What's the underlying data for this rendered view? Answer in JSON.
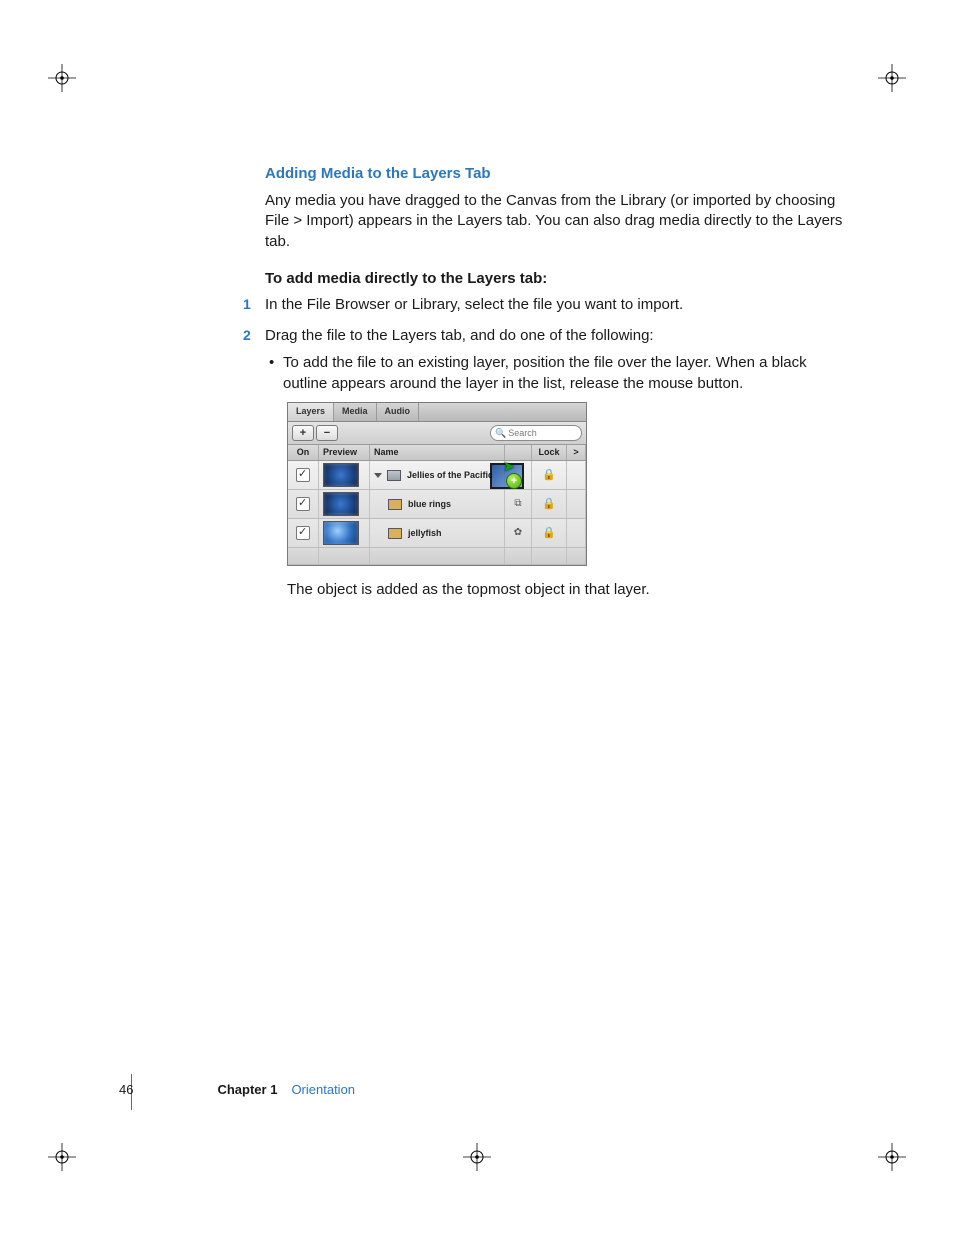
{
  "heading": "Adding Media to the Layers Tab",
  "intro": "Any media you have dragged to the Canvas from the Library (or imported by choosing File > Import) appears in the Layers tab. You can also drag media directly to the Layers tab.",
  "subhead": "To add media directly to the Layers tab:",
  "steps": {
    "s1": "In the File Browser or Library, select the file you want to import.",
    "s2": "Drag the file to the Layers tab, and do one of the following:",
    "bullet1": "To add the file to an existing layer, position the file over the layer. When a black outline appears around the layer in the list, release the mouse button."
  },
  "afterPanel": "The object is added as the topmost object in that layer.",
  "panel": {
    "tabs": {
      "t1": "Layers",
      "t2": "Media",
      "t3": "Audio"
    },
    "addLabel": "+",
    "removeLabel": "−",
    "searchPlaceholder": "Search",
    "cols": {
      "on": "On",
      "preview": "Preview",
      "name": "Name",
      "lock": "Lock",
      "expand": ">"
    },
    "rows": {
      "r1": {
        "name": "Jellies of the Pacific"
      },
      "r2": {
        "name": "blue rings"
      },
      "r3": {
        "name": "jellyfish"
      }
    }
  },
  "footer": {
    "page": "46",
    "chapter": "Chapter 1",
    "title": "Orientation"
  }
}
